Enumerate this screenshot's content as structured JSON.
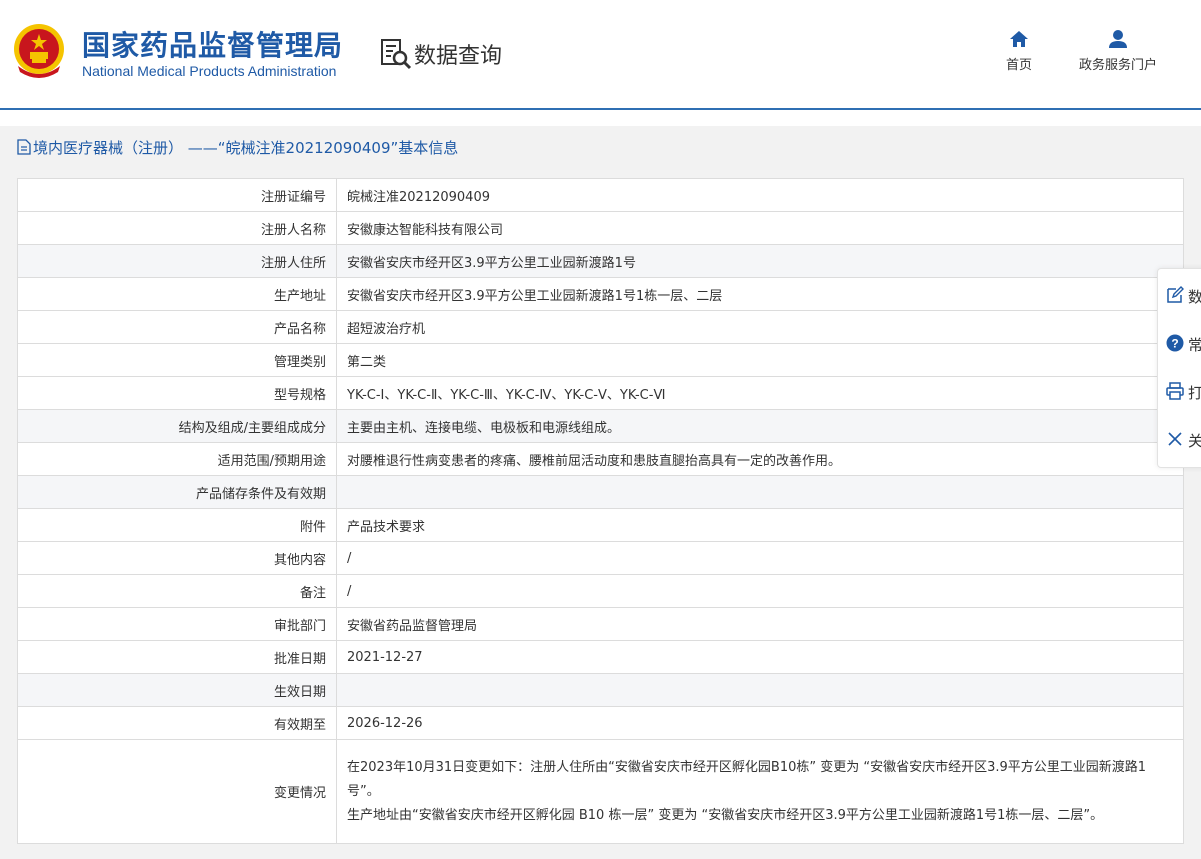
{
  "header": {
    "logo_cn": "国家药品监督管理局",
    "logo_en": "National Medical Products Administration",
    "query_title": "数据查询",
    "nav": [
      {
        "label": "首页",
        "icon": "home-icon"
      },
      {
        "label": "政务服务门户",
        "icon": "user-icon"
      }
    ]
  },
  "panel": {
    "title": "境内医疗器械（注册） ——“皖械注准20212090409”基本信息"
  },
  "rows": [
    {
      "label": "注册证编号",
      "value": "皖械注准20212090409"
    },
    {
      "label": "注册人名称",
      "value": "安徽康达智能科技有限公司"
    },
    {
      "label": "注册人住所",
      "value": "安徽省安庆市经开区3.9平方公里工业园新渡路1号"
    },
    {
      "label": "生产地址",
      "value": "安徽省安庆市经开区3.9平方公里工业园新渡路1号1栋一层、二层"
    },
    {
      "label": "产品名称",
      "value": "超短波治疗机"
    },
    {
      "label": "管理类别",
      "value": "第二类"
    },
    {
      "label": "型号规格",
      "value": "YK-C-Ⅰ、YK-C-Ⅱ、YK-C-Ⅲ、YK-C-Ⅳ、YK-C-Ⅴ、YK-C-Ⅵ"
    },
    {
      "label": "结构及组成/主要组成成分",
      "value": "主要由主机、连接电缆、电极板和电源线组成。"
    },
    {
      "label": "适用范围/预期用途",
      "value": "对腰椎退行性病变患者的疼痛、腰椎前屈活动度和患肢直腿抬高具有一定的改善作用。"
    },
    {
      "label": "产品储存条件及有效期",
      "value": ""
    },
    {
      "label": "附件",
      "value": "产品技术要求"
    },
    {
      "label": "其他内容",
      "value": "/"
    },
    {
      "label": "备注",
      "value": "/"
    },
    {
      "label": "审批部门",
      "value": "安徽省药品监督管理局"
    },
    {
      "label": "批准日期",
      "value": "2021-12-27"
    },
    {
      "label": "生效日期",
      "value": ""
    },
    {
      "label": "有效期至",
      "value": "2026-12-26"
    }
  ],
  "change": {
    "label": "变更情况",
    "lines": [
      "在2023年10月31日变更如下：注册人住所由“安徽省安庆市经开区孵化园B10栋” 变更为 “安徽省安庆市经开区3.9平方公里工业园新渡路1号”。",
      "生产地址由“安徽省安庆市经开区孵化园 B10 栋一层” 变更为 “安徽省安庆市经开区3.9平方公里工业园新渡路1号1栋一层、二层”。"
    ]
  },
  "side_bar": [
    {
      "label": "数",
      "icon": "edit-icon"
    },
    {
      "label": "常",
      "icon": "help-icon"
    },
    {
      "label": "打",
      "icon": "print-icon"
    },
    {
      "label": "关",
      "icon": "close-icon"
    }
  ],
  "colors": {
    "brand": "#1f5aa6",
    "header_rule": "#2f6fb3",
    "panel_bg": "#f2f2f2",
    "row_alt": "#f5f6f8",
    "border": "#dcdcdc",
    "emblem_red": "#c8161d",
    "emblem_gold": "#f5c400"
  }
}
